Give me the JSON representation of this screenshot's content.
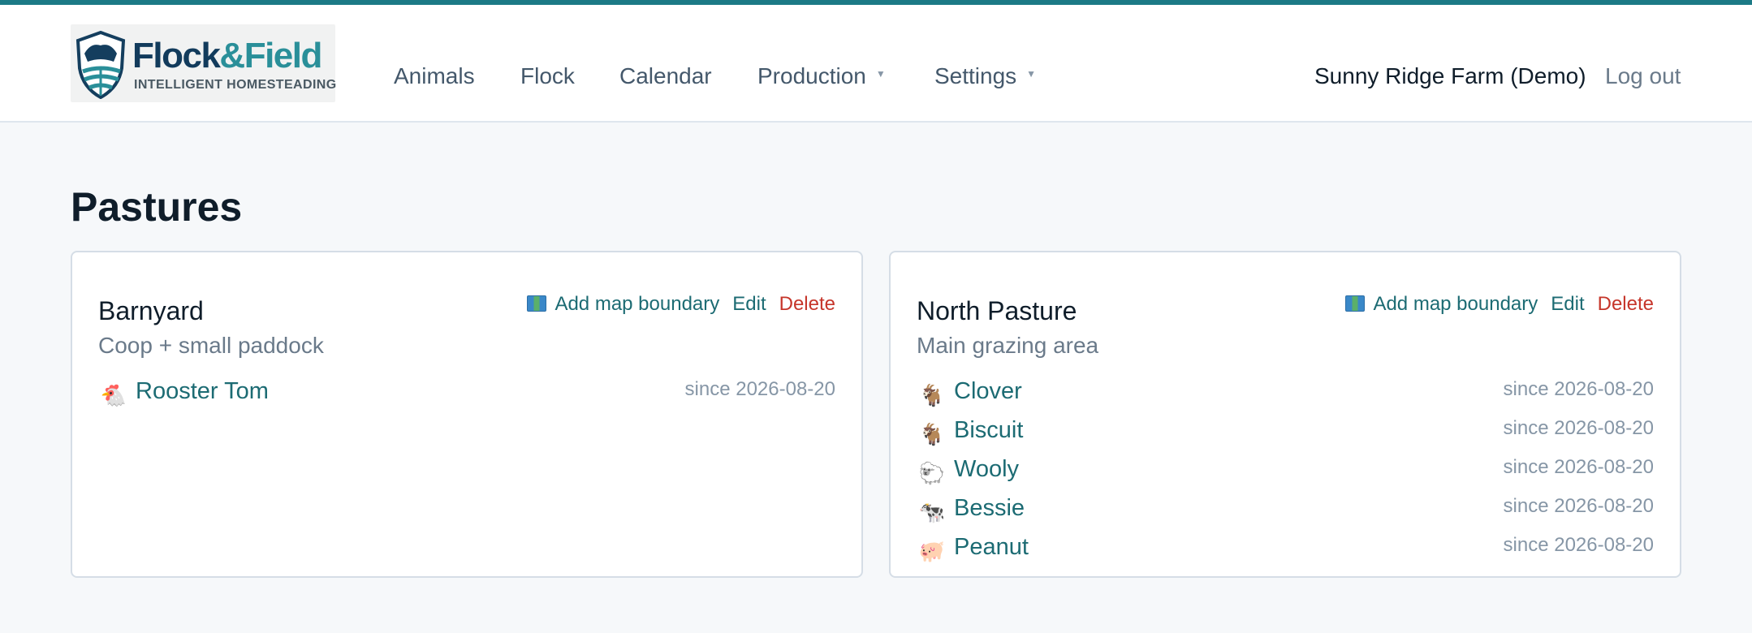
{
  "brand": {
    "name_part1": "Flock",
    "name_amp": "&",
    "name_part2": "Field",
    "tagline": "INTELLIGENT HOMESTEADING",
    "accent_color": "#1c7a86"
  },
  "nav": {
    "items": [
      {
        "label": "Animals"
      },
      {
        "label": "Flock"
      },
      {
        "label": "Calendar"
      },
      {
        "label": "Production",
        "caret": "▼"
      },
      {
        "label": "Settings",
        "caret": "▼"
      }
    ]
  },
  "user": {
    "farm_name": "Sunny Ridge Farm (Demo)",
    "logout_label": "Log out"
  },
  "page": {
    "title": "Pastures"
  },
  "pastures": [
    {
      "name": "Barnyard",
      "description": "Coop + small paddock",
      "actions": {
        "map_label": "Add map boundary",
        "edit_label": "Edit",
        "delete_label": "Delete"
      },
      "animals": [
        {
          "icon": "rooster-icon",
          "glyph": "🐔",
          "name": "Rooster Tom",
          "since": "since 2026-08-20"
        }
      ]
    },
    {
      "name": "North Pasture",
      "description": "Main grazing area",
      "actions": {
        "map_label": "Add map boundary",
        "edit_label": "Edit",
        "delete_label": "Delete"
      },
      "animals": [
        {
          "icon": "goat-icon",
          "glyph": "🐐",
          "name": "Clover",
          "since": "since 2026-08-20"
        },
        {
          "icon": "goat-icon",
          "glyph": "🐐",
          "name": "Biscuit",
          "since": "since 2026-08-20"
        },
        {
          "icon": "sheep-icon",
          "glyph": "🐑",
          "name": "Wooly",
          "since": "since 2026-08-20"
        },
        {
          "icon": "cow-icon",
          "glyph": "🐄",
          "name": "Bessie",
          "since": "since 2026-08-20"
        },
        {
          "icon": "pig-icon",
          "glyph": "🐖",
          "name": "Peanut",
          "since": "since 2026-08-20"
        }
      ]
    }
  ]
}
